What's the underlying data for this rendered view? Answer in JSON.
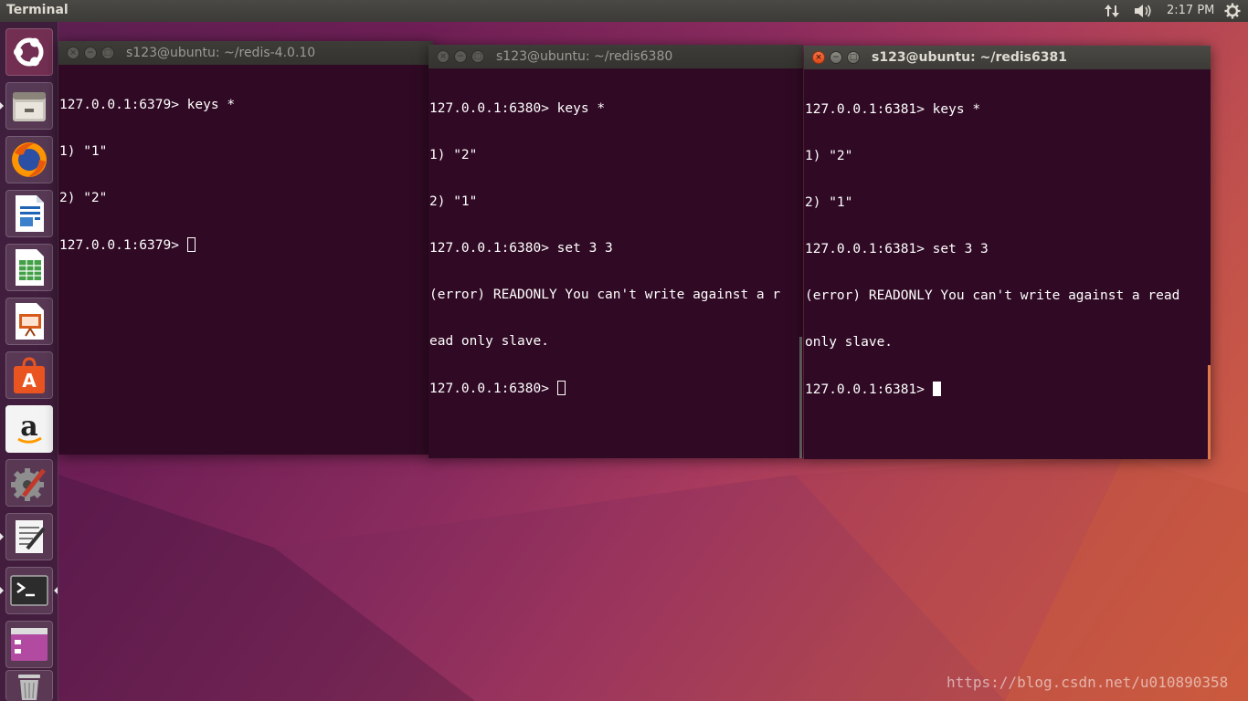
{
  "top_panel": {
    "app_title": "Terminal",
    "clock": "2:17 PM",
    "indicators": [
      "network-icon",
      "volume-icon",
      "system-gear-icon"
    ]
  },
  "launcher": {
    "items": [
      "ubuntu-dash",
      "files",
      "firefox",
      "libreoffice-writer",
      "libreoffice-calc",
      "libreoffice-impress",
      "ubuntu-software",
      "amazon",
      "system-settings",
      "text-editor",
      "terminal",
      "workspace-switcher",
      "trash"
    ]
  },
  "windows": [
    {
      "title": "s123@ubuntu: ~/redis-4.0.10",
      "state": "inactive",
      "lines": [
        "127.0.0.1:6379> keys *",
        "1) \"1\"",
        "2) \"2\"",
        "127.0.0.1:6379> "
      ]
    },
    {
      "title": "s123@ubuntu: ~/redis6380",
      "state": "inactive",
      "lines": [
        "127.0.0.1:6380> keys *",
        "1) \"2\"",
        "2) \"1\"",
        "127.0.0.1:6380> set 3 3",
        "(error) READONLY You can't write against a r",
        "ead only slave.",
        "127.0.0.1:6380> "
      ]
    },
    {
      "title": "s123@ubuntu: ~/redis6381",
      "state": "active",
      "lines": [
        "127.0.0.1:6381> keys *",
        "1) \"2\"",
        "2) \"1\"",
        "127.0.0.1:6381> set 3 3",
        "(error) READONLY You can't write against a read",
        "only slave.",
        "127.0.0.1:6381> "
      ]
    }
  ],
  "window_buttons": {
    "close": "×",
    "minimize": "−",
    "maximize": "□"
  },
  "watermark": "https://blog.csdn.net/u010890358",
  "colors": {
    "terminal_bg": "#300a24",
    "panel_bg": "#3c3b37",
    "close_button": "#df4a16"
  }
}
